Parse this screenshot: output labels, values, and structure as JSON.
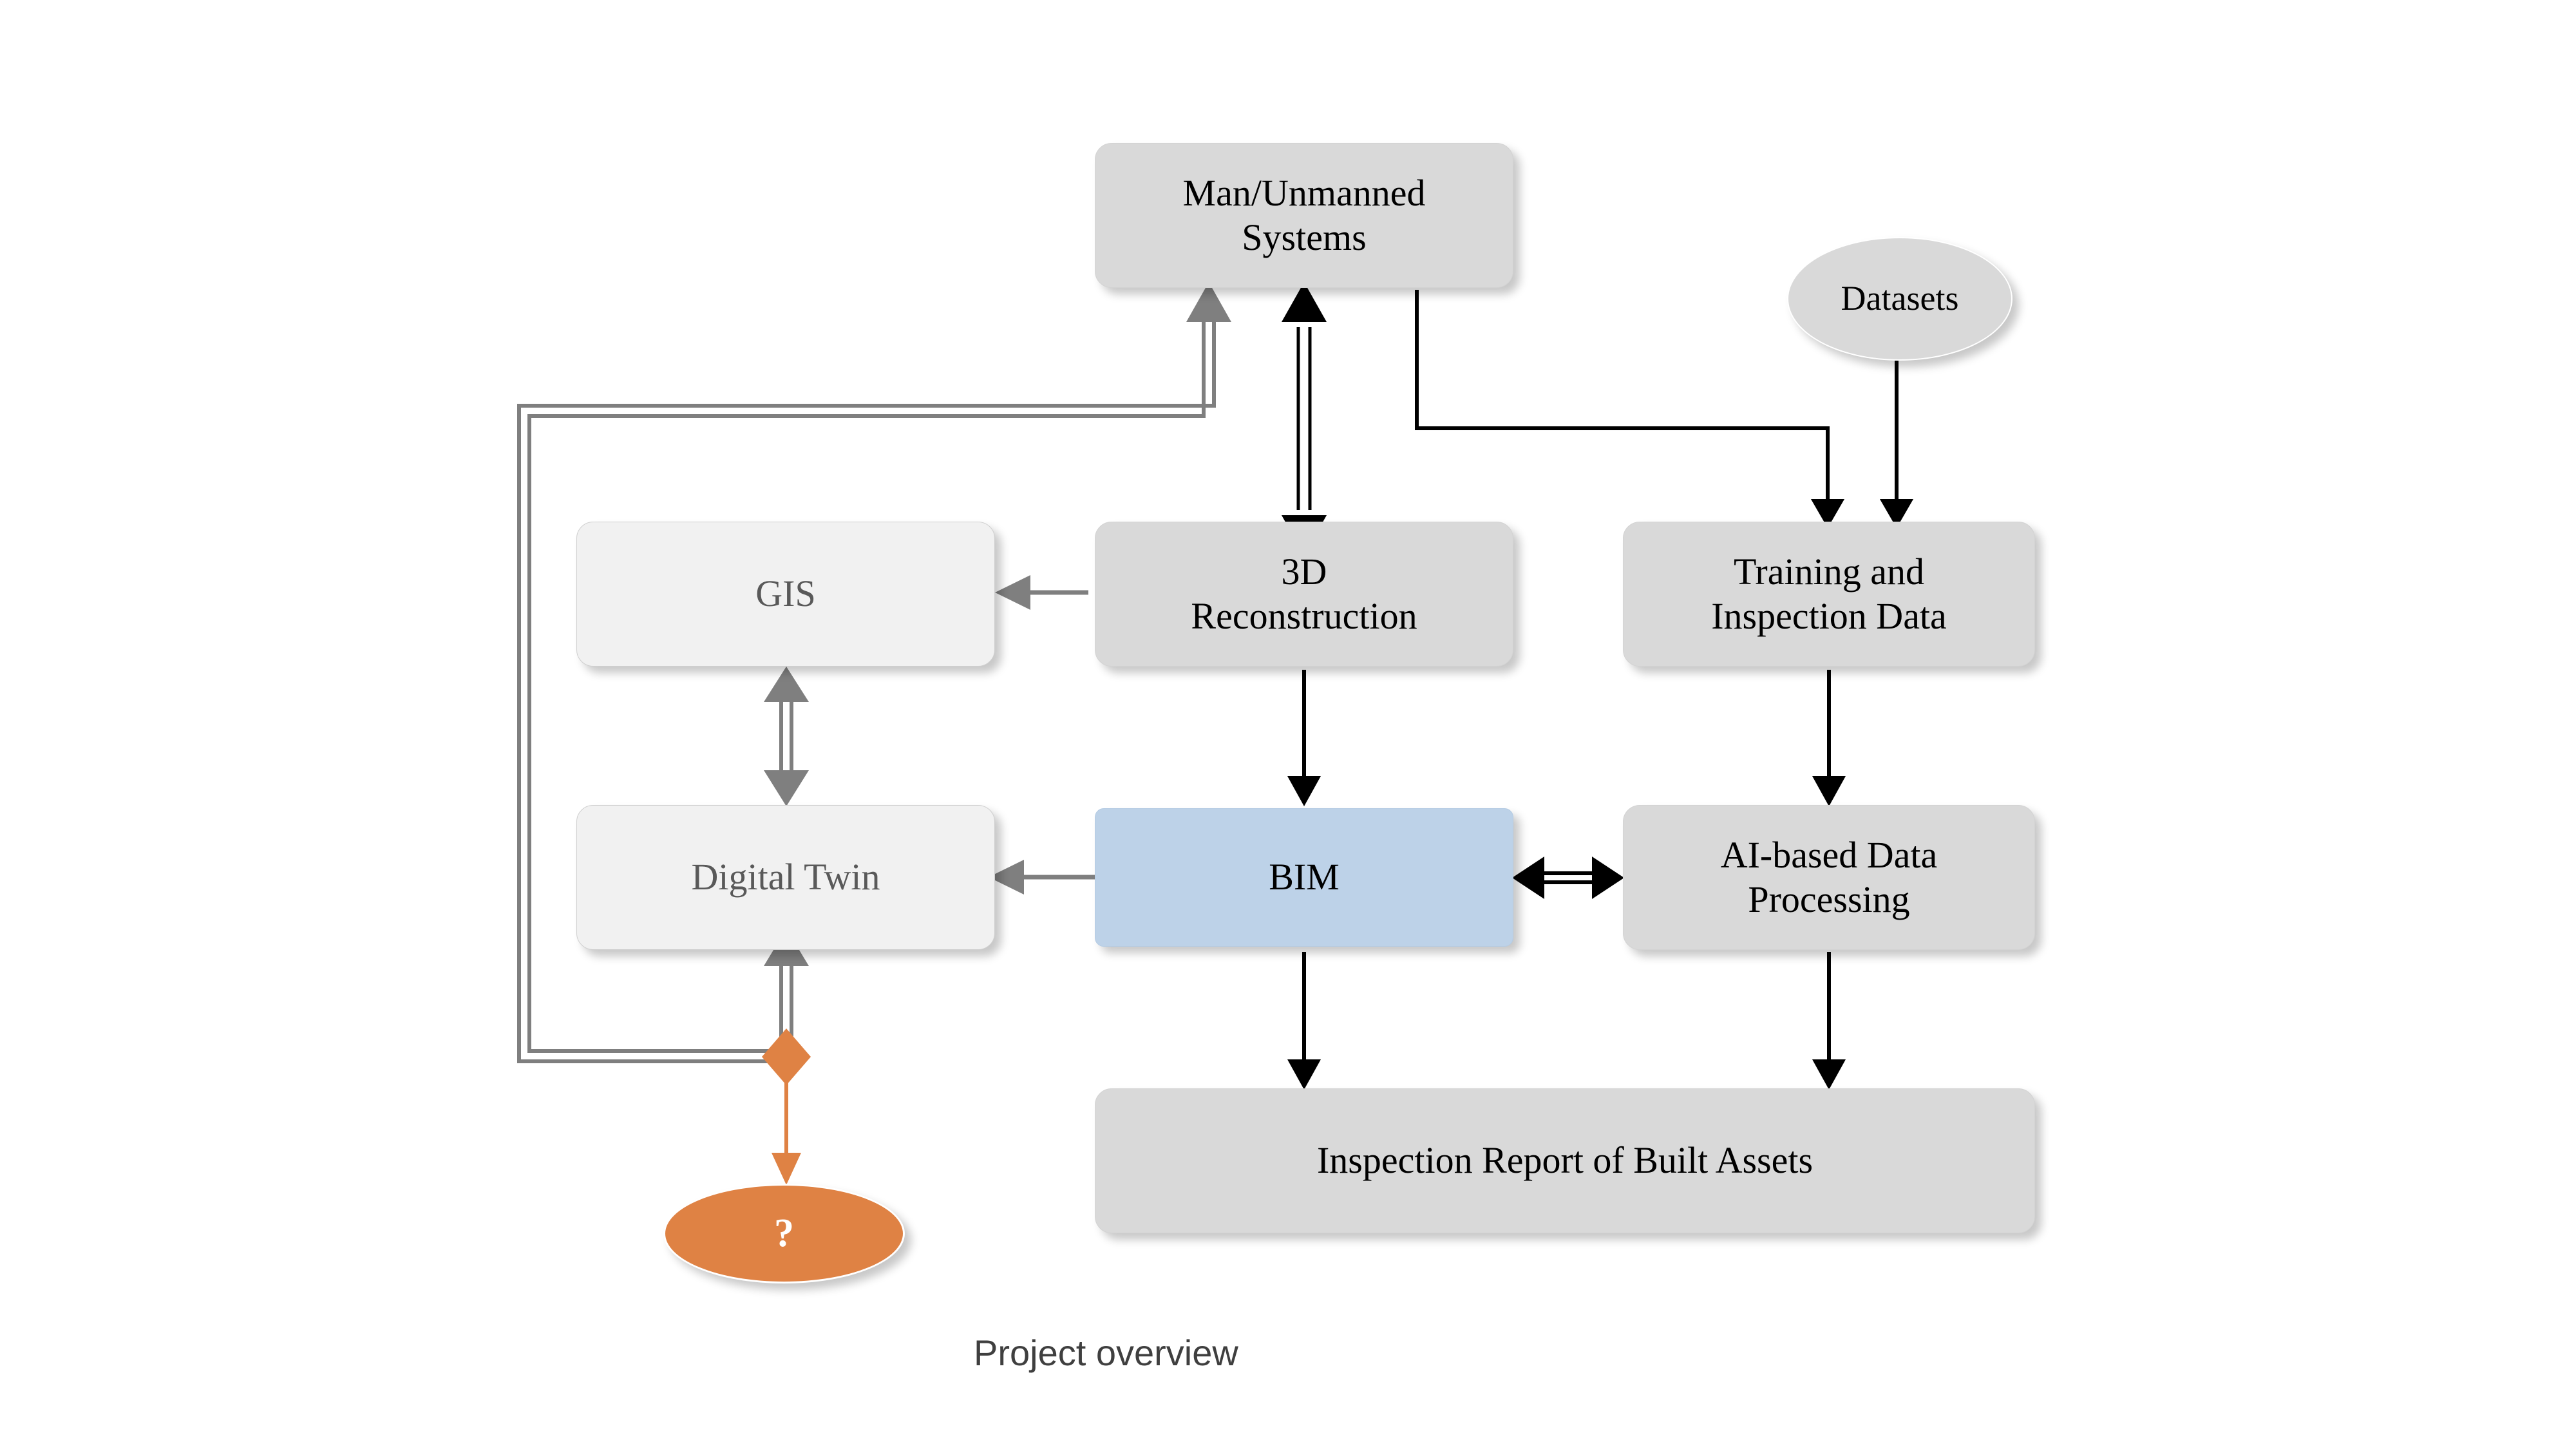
{
  "diagram": {
    "caption": "Project overview",
    "background": "#ffffff",
    "colors": {
      "box_gray_fill": "#d9d9d9",
      "box_light_fill": "#f1f1f1",
      "box_blue_fill": "#bdd2e8",
      "ellipse_gray_fill": "#d9d9d9",
      "ellipse_orange_fill": "#df8244",
      "arrow_black": "#000000",
      "arrow_gray": "#7f7f7f",
      "arrow_orange": "#df8244",
      "text_dark": "#000000",
      "text_muted": "#595959",
      "caption_color": "#3f3f3f"
    },
    "nodes": [
      {
        "id": "man-unmanned-systems",
        "label": "Man/Unmanned\nSystems",
        "shape": "rounded-rect",
        "style": "gray"
      },
      {
        "id": "datasets",
        "label": "Datasets",
        "shape": "ellipse",
        "style": "gray"
      },
      {
        "id": "gis",
        "label": "GIS",
        "shape": "rounded-rect",
        "style": "light"
      },
      {
        "id": "3d-reconstruction",
        "label": "3D\nReconstruction",
        "shape": "rounded-rect",
        "style": "gray"
      },
      {
        "id": "training-inspection-data",
        "label": "Training and\nInspection Data",
        "shape": "rounded-rect",
        "style": "gray"
      },
      {
        "id": "digital-twin",
        "label": "Digital Twin",
        "shape": "rounded-rect",
        "style": "light"
      },
      {
        "id": "bim",
        "label": "BIM",
        "shape": "rounded-rect",
        "style": "blue"
      },
      {
        "id": "ai-based-data-processing",
        "label": "AI-based Data\nProcessing",
        "shape": "rounded-rect",
        "style": "gray"
      },
      {
        "id": "inspection-report",
        "label": "Inspection Report of Built Assets",
        "shape": "rounded-rect",
        "style": "gray"
      },
      {
        "id": "unknown-question",
        "label": "?",
        "shape": "ellipse",
        "style": "orange"
      }
    ],
    "edges": [
      {
        "from": "3d-reconstruction",
        "to": "man-unmanned-systems",
        "type": "double-line",
        "arrows": "both",
        "color": "#000000"
      },
      {
        "from": "man-unmanned-systems",
        "to": "training-inspection-data",
        "type": "single-line",
        "arrows": "to",
        "color": "#000000"
      },
      {
        "from": "datasets",
        "to": "training-inspection-data",
        "type": "single-line",
        "arrows": "to",
        "color": "#000000"
      },
      {
        "from": "3d-reconstruction",
        "to": "gis",
        "type": "single-line",
        "arrows": "to",
        "color": "#7f7f7f"
      },
      {
        "from": "3d-reconstruction",
        "to": "bim",
        "type": "single-line",
        "arrows": "to",
        "color": "#000000"
      },
      {
        "from": "training-inspection-data",
        "to": "ai-based-data-processing",
        "type": "single-line",
        "arrows": "to",
        "color": "#000000"
      },
      {
        "from": "gis",
        "to": "digital-twin",
        "type": "double-line",
        "arrows": "both",
        "color": "#7f7f7f"
      },
      {
        "from": "bim",
        "to": "digital-twin",
        "type": "single-line",
        "arrows": "to",
        "color": "#7f7f7f"
      },
      {
        "from": "bim",
        "to": "ai-based-data-processing",
        "type": "single-line",
        "arrows": "both",
        "color": "#000000"
      },
      {
        "from": "bim",
        "to": "inspection-report",
        "type": "single-line",
        "arrows": "to",
        "color": "#000000"
      },
      {
        "from": "ai-based-data-processing",
        "to": "inspection-report",
        "type": "single-line",
        "arrows": "to",
        "color": "#000000"
      },
      {
        "from": "digital-twin",
        "to": "man-unmanned-systems",
        "type": "double-line-route",
        "arrows": "to",
        "color": "#7f7f7f"
      },
      {
        "from": "junction",
        "to": "unknown-question",
        "type": "single-line",
        "arrows": "to",
        "color": "#df8244"
      },
      {
        "from": "bim",
        "to": "bim",
        "type": "dash-dot-axis",
        "arrows": "none",
        "color": "#666666"
      }
    ]
  }
}
